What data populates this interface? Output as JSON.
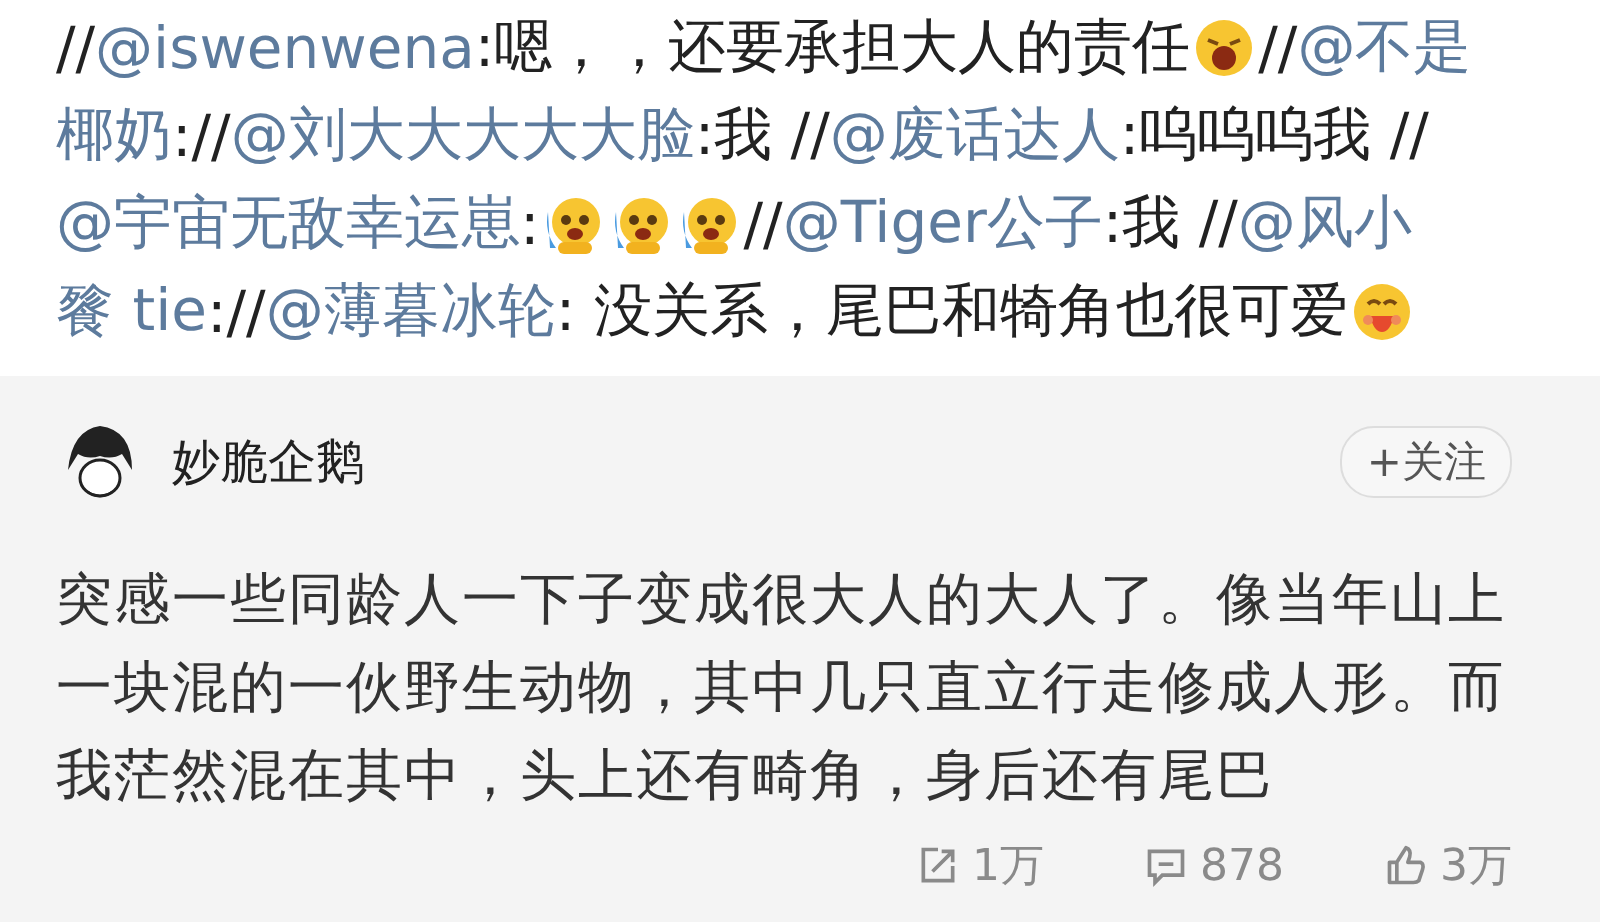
{
  "repost_lines": [
    [
      {
        "kind": "text",
        "text": "//"
      },
      {
        "kind": "mention",
        "text": "@iswenwena"
      },
      {
        "kind": "text",
        "text": ":嗯，，还要承担大人的责任"
      },
      {
        "kind": "shout"
      },
      {
        "kind": "text",
        "text": "//"
      },
      {
        "kind": "mention",
        "text": "@不是"
      }
    ],
    [
      {
        "kind": "mention",
        "text": "椰奶"
      },
      {
        "kind": "text",
        "text": "://"
      },
      {
        "kind": "mention",
        "text": "@刘大大大大大脸"
      },
      {
        "kind": "text",
        "text": ":我 //"
      },
      {
        "kind": "mention",
        "text": "@废话达人"
      },
      {
        "kind": "text",
        "text": ":呜呜呜我 //"
      }
    ],
    [
      {
        "kind": "mention",
        "text": "@宇宙无敌幸运崽"
      },
      {
        "kind": "text",
        "text": ":"
      },
      {
        "kind": "sob"
      },
      {
        "kind": "sob"
      },
      {
        "kind": "sob"
      },
      {
        "kind": "text",
        "text": "//"
      },
      {
        "kind": "mention",
        "text": "@Tiger公子"
      },
      {
        "kind": "text",
        "text": ":我 //"
      },
      {
        "kind": "mention",
        "text": "@风小"
      }
    ],
    [
      {
        "kind": "mention",
        "text": "餮 tie"
      },
      {
        "kind": "text",
        "text": "://"
      },
      {
        "kind": "mention",
        "text": "@薄暮冰轮"
      },
      {
        "kind": "text",
        "text": ": 没关系，尾巴和犄角也很可爱"
      },
      {
        "kind": "blush"
      }
    ]
  ],
  "post": {
    "author": "妙脆企鹅",
    "follow_button": "+关注",
    "body": "突感一些同龄人一下子变成很大人的大人了。像当年山上一块混的一伙野生动物，其中几只直立行走修成人形。而我茫然混在其中，头上还有畸角，身后还有尾巴",
    "stats": [
      {
        "kind": "repost",
        "text": "1万"
      },
      {
        "kind": "comment",
        "text": "878"
      },
      {
        "kind": "like",
        "text": "3万"
      }
    ]
  }
}
